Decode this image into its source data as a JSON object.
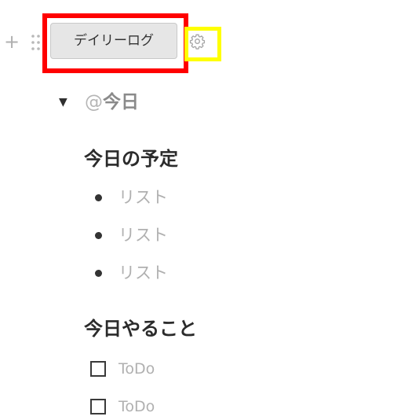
{
  "block_controls": {
    "add_icon_glyph": "+",
    "add_icon": "plus-icon",
    "drag_icon": "drag-handle-icon",
    "settings_icon": "gear-icon"
  },
  "template_button": {
    "label": "デイリーログ"
  },
  "annotations": {
    "template_button_highlight_color": "#ff0000",
    "settings_highlight_color": "#ffff00"
  },
  "toggle": {
    "arrow": "▼",
    "mention": "@",
    "title": "今日"
  },
  "sections": [
    {
      "heading": "今日の予定",
      "bullets": [
        "リスト",
        "リスト",
        "リスト"
      ]
    },
    {
      "heading": "今日やること",
      "todos": [
        "ToDo",
        "ToDo"
      ]
    }
  ]
}
